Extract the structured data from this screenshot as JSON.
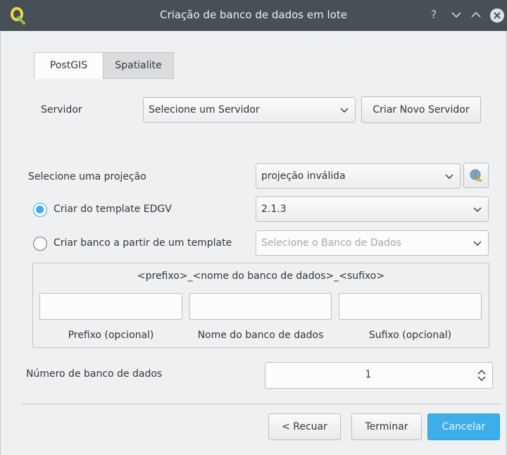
{
  "window": {
    "title": "Criação de banco de dados em lote",
    "help_glyph": "?",
    "minimize_glyph": "⌄",
    "maximize_glyph": "⌃"
  },
  "tabs": [
    {
      "label": "PostGIS",
      "active": true
    },
    {
      "label": "Spatialite",
      "active": false
    }
  ],
  "server": {
    "label": "Servidor",
    "select_value": "Selecione um Servidor",
    "new_button": "Criar Novo Servidor"
  },
  "projection": {
    "label": "Selecione uma projeção",
    "select_value": "projeção inválida",
    "picker_icon": "projection-globe-icon"
  },
  "template_edgv": {
    "label": "Criar do template EDGV",
    "checked": true,
    "select_value": "2.1.3"
  },
  "template_db": {
    "label": "Criar banco a partir de um template",
    "checked": false,
    "select_placeholder": "Selecione o Banco de Dados"
  },
  "naming": {
    "pattern": "<prefixo>_<nome do banco de dados>_<sufixo>",
    "prefix_value": "",
    "name_value": "",
    "suffix_value": "",
    "prefix_label": "Prefixo (opcional)",
    "name_label": "Nome do banco de dados",
    "suffix_label": "Sufixo (opcional)"
  },
  "count": {
    "label": "Número de banco de dados",
    "value": "1"
  },
  "buttons": {
    "back": "< Recuar",
    "finish": "Terminar",
    "cancel": "Cancelar"
  },
  "colors": {
    "titlebar": "#475057",
    "accent": "#3daee9",
    "background": "#eff0f1"
  }
}
